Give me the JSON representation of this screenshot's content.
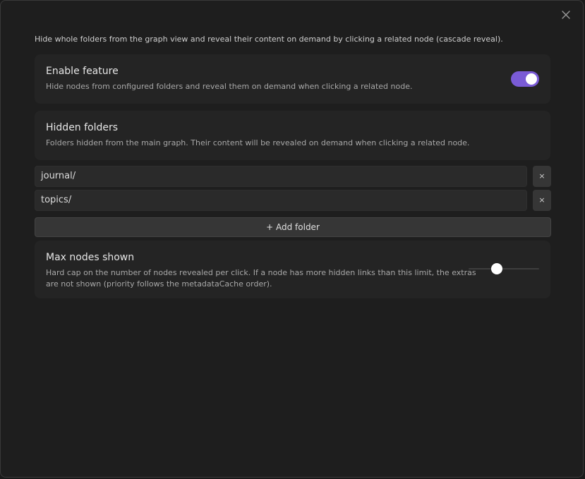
{
  "intro": "Hide whole folders from the graph view and reveal their content on demand by clicking a related node (cascade reveal).",
  "enable": {
    "title": "Enable feature",
    "desc": "Hide nodes from configured folders and reveal them on demand when clicking a related node.",
    "enabled": true,
    "accent": "#7a5bd6"
  },
  "hidden_folders": {
    "title": "Hidden folders",
    "desc": "Folders hidden from the main graph. Their content will be revealed on demand when clicking a related node.",
    "items": [
      {
        "value": "journal/",
        "remove_label": "×"
      },
      {
        "value": "topics/",
        "remove_label": "×"
      }
    ],
    "add_label": "+ Add folder"
  },
  "max_nodes": {
    "title": "Max nodes shown",
    "desc_line1": "Hard cap on the number of nodes revealed per click. If a node has more hidden links than this limit, the extras",
    "desc_line2": "are not shown (priority follows the metadataCache order).",
    "slider_fraction": 0.4
  },
  "icons": {
    "close": "close-icon"
  }
}
